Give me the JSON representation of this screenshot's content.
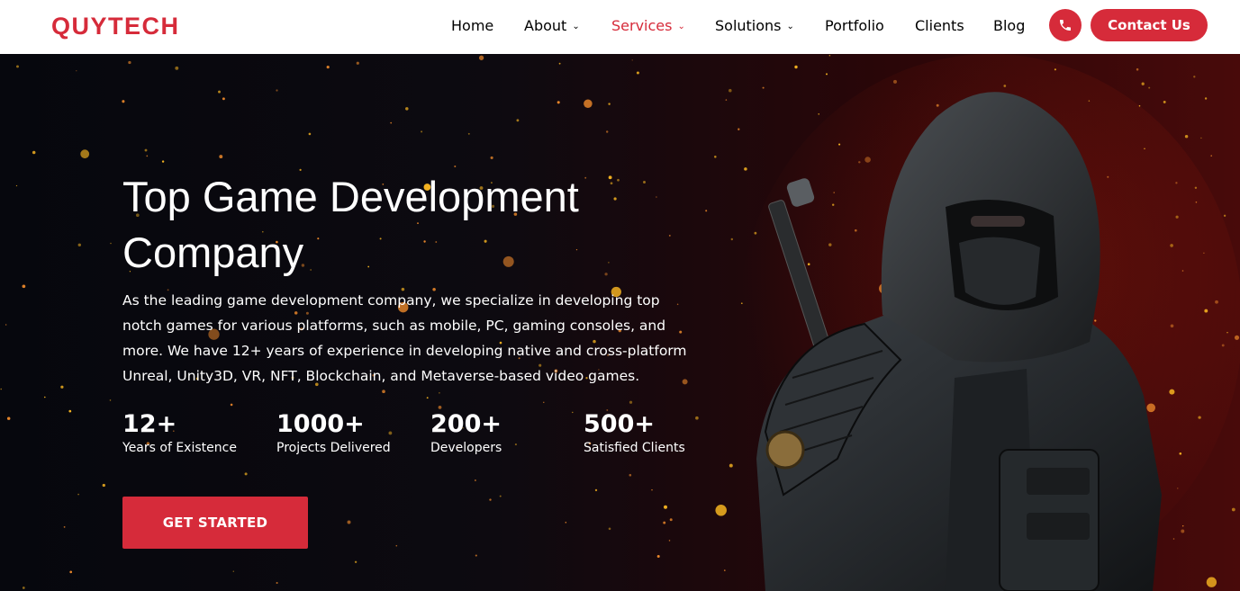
{
  "brand": {
    "logo_text": "QUYTECH",
    "accent_color": "#d62b3a"
  },
  "nav": {
    "items": [
      {
        "label": "Home",
        "has_dropdown": false
      },
      {
        "label": "About",
        "has_dropdown": true
      },
      {
        "label": "Services",
        "has_dropdown": true,
        "active": true
      },
      {
        "label": "Solutions",
        "has_dropdown": true
      },
      {
        "label": "Portfolio",
        "has_dropdown": false
      },
      {
        "label": "Clients",
        "has_dropdown": false
      },
      {
        "label": "Blog",
        "has_dropdown": false
      }
    ],
    "phone_icon": "phone-icon",
    "contact_label": "Contact Us"
  },
  "hero": {
    "title": "Top Game Development Company",
    "description": "As the leading game development company, we specialize in developing top notch games for various platforms, such as mobile, PC, gaming consoles, and more. We have 12+ years of experience in developing native and cross-platform Unreal, Unity3D, VR, NFT, Blockchain, and Metaverse-based video games.",
    "stats": [
      {
        "value": "12+",
        "label": "Years of Existence"
      },
      {
        "value": "1000+",
        "label": "Projects Delivered"
      },
      {
        "value": "200+",
        "label": "Developers"
      },
      {
        "value": "500+",
        "label": "Satisfied Clients"
      }
    ],
    "cta_label": "GET STARTED"
  }
}
